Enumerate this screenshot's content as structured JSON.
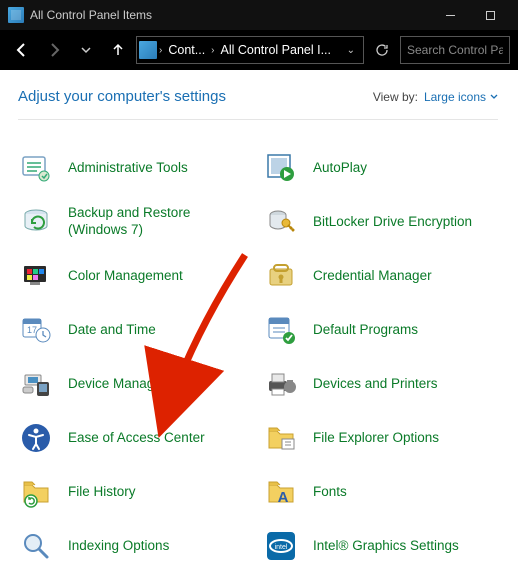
{
  "titlebar": {
    "title": "All Control Panel Items"
  },
  "nav": {
    "crumb1": "Cont...",
    "crumb2": "All Control Panel I...",
    "search_placeholder": "Search Control Pa"
  },
  "header": {
    "title": "Adjust your computer's settings",
    "viewby_label": "View by:",
    "viewby_value": "Large icons"
  },
  "items": {
    "left": [
      "Administrative Tools",
      "Backup and Restore (Windows 7)",
      "Color Management",
      "Date and Time",
      "Device Manager",
      "Ease of Access Center",
      "File History",
      "Indexing Options"
    ],
    "right": [
      "AutoPlay",
      "BitLocker Drive Encryption",
      "Credential Manager",
      "Default Programs",
      "Devices and Printers",
      "File Explorer Options",
      "Fonts",
      "Intel® Graphics Settings"
    ]
  }
}
